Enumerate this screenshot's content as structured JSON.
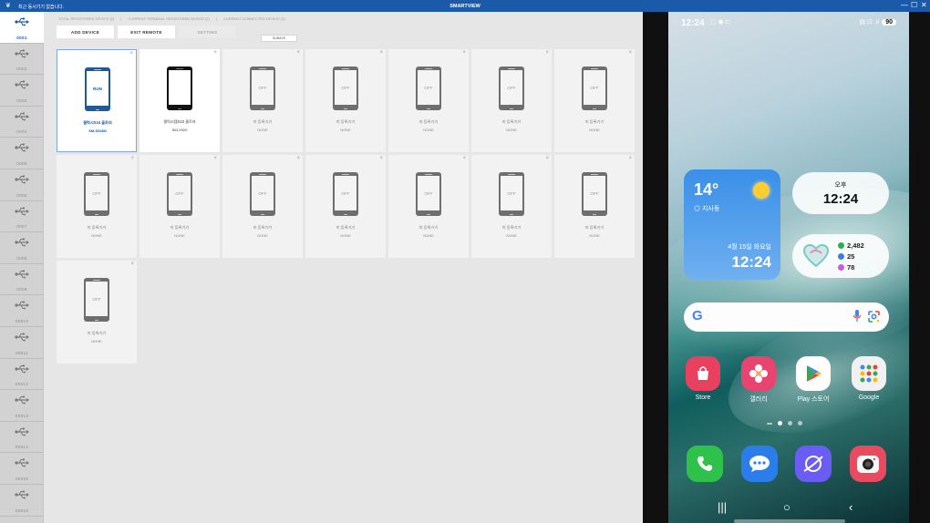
{
  "window": {
    "title": "SMARTVIEW",
    "notice": "최근 동시기기 없습니다.",
    "controls": [
      "—",
      "☐",
      "✕"
    ]
  },
  "stats": {
    "total_registered": "TOTAL REGISTERED DEVICE [2]",
    "terminal_registered": "CURRENT TERMINAL REGISTERED DEVICE [2]",
    "connected": "CURRENT CONNECTED DEVICE [2]",
    "separator": "|"
  },
  "toolbar": {
    "add_device": "ADD DEVICE",
    "exit_remote": "EXIT REMOTE",
    "setting": "SETTING",
    "sub_badge": "SUBAYE"
  },
  "sidebar": {
    "items": [
      "0001",
      "0002",
      "0003",
      "0004",
      "0005",
      "0006",
      "0007",
      "0008",
      "0009",
      "00010",
      "00011",
      "00012",
      "00013",
      "00014",
      "00015",
      "00016"
    ]
  },
  "devices": [
    {
      "status": "RUN",
      "name": "갤럭시S24 울트라",
      "model": "SM-S928N",
      "style": "run"
    },
    {
      "status": "",
      "name": "갤럭시탭S10 울트라",
      "model": "SM-X920",
      "style": "black"
    },
    {
      "status": "OFF",
      "name": "미 등록기기",
      "model": "NONE",
      "style": "off"
    },
    {
      "status": "OFF",
      "name": "미 등록기기",
      "model": "NONE",
      "style": "off"
    },
    {
      "status": "OFF",
      "name": "미 등록기기",
      "model": "NONE",
      "style": "off"
    },
    {
      "status": "OFF",
      "name": "미 등록기기",
      "model": "NONE",
      "style": "off"
    },
    {
      "status": "OFF",
      "name": "미 등록기기",
      "model": "NONE",
      "style": "off"
    },
    {
      "status": "OFF",
      "name": "미 등록기기",
      "model": "NONE",
      "style": "off"
    },
    {
      "status": "OFF",
      "name": "미 등록기기",
      "model": "NONE",
      "style": "off"
    },
    {
      "status": "OFF",
      "name": "미 등록기기",
      "model": "NONE",
      "style": "off"
    },
    {
      "status": "OFF",
      "name": "미 등록기기",
      "model": "NONE",
      "style": "off"
    },
    {
      "status": "OFF",
      "name": "미 등록기기",
      "model": "NONE",
      "style": "off"
    },
    {
      "status": "OFF",
      "name": "미 등록기기",
      "model": "NONE",
      "style": "off"
    },
    {
      "status": "OFF",
      "name": "미 등록기기",
      "model": "NONE",
      "style": "off"
    },
    {
      "status": "OFF",
      "name": "미 등록기기",
      "model": "NONE",
      "style": "off"
    }
  ],
  "close_glyph": "×",
  "phone": {
    "time": "12:24",
    "battery": "90",
    "weather": {
      "temp": "14°",
      "location": "◎ 지사동",
      "date": "4월 15일 화요일",
      "time": "12:24"
    },
    "clock": {
      "ampm": "오후",
      "time": "12:24"
    },
    "health": {
      "steps": "2,482",
      "active": "25",
      "heart": "78",
      "colors": [
        "#2fae4f",
        "#3c7de0",
        "#d35ad6"
      ]
    },
    "search": {
      "logo": "G"
    },
    "apps": [
      {
        "label": "Store",
        "color": "#e8405f"
      },
      {
        "label": "갤러리",
        "color": "#e9446f"
      },
      {
        "label": "Play 스토어",
        "color": "#ffffff"
      },
      {
        "label": "Google",
        "color": "#f1f1f1"
      }
    ],
    "dock": [
      {
        "name": "phone",
        "color": "#2ec24a"
      },
      {
        "name": "messages",
        "color": "#2b7de9"
      },
      {
        "name": "internet",
        "color": "#6b5cf5"
      },
      {
        "name": "camera",
        "color": "#e84a5f"
      }
    ],
    "nav": {
      "recents": "|||",
      "home": "○",
      "back": "‹"
    }
  }
}
